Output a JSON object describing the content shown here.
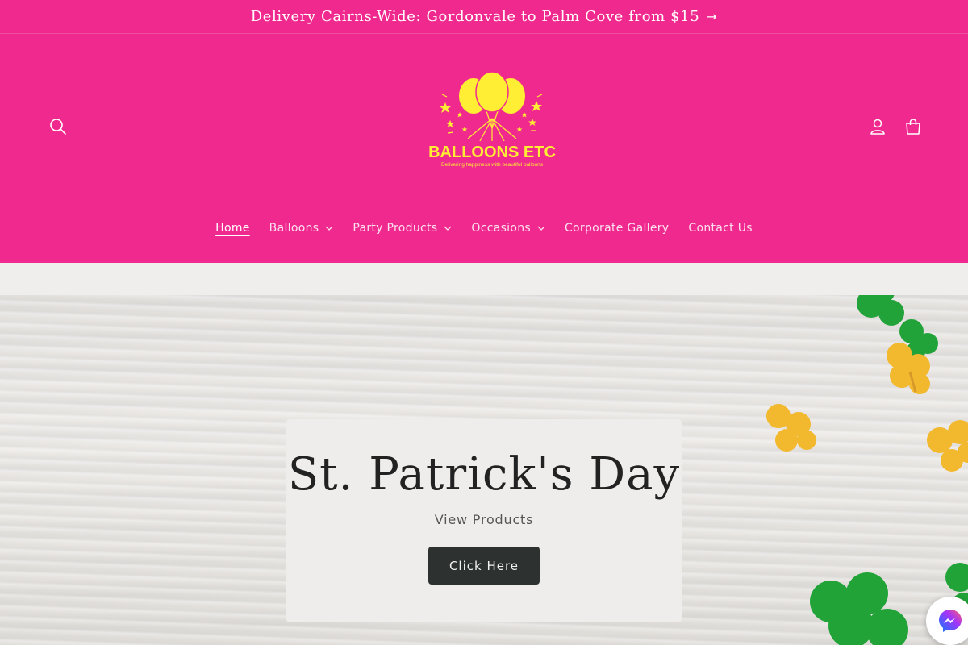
{
  "announcement": {
    "text": "Delivery Cairns-Wide: Gordonvale to Palm Cove from $15",
    "arrow": "→"
  },
  "header": {
    "icons": [
      "search-icon",
      "account-icon",
      "cart-icon"
    ],
    "background_color": "#f0298f",
    "logo": {
      "brand": "BALLOONS ETC",
      "tagline": "Delivering happiness with beautiful balloons",
      "color": "#ffee33"
    }
  },
  "nav": {
    "items": [
      {
        "label": "Home",
        "active": true,
        "has_dropdown": false
      },
      {
        "label": "Balloons",
        "active": false,
        "has_dropdown": true
      },
      {
        "label": "Party Products",
        "active": false,
        "has_dropdown": true
      },
      {
        "label": "Occasions",
        "active": false,
        "has_dropdown": true
      },
      {
        "label": "Corporate Gallery",
        "active": false,
        "has_dropdown": false
      },
      {
        "label": "Contact Us",
        "active": false,
        "has_dropdown": false
      }
    ]
  },
  "hero": {
    "title": "St. Patrick's Day",
    "subtitle": "View Products",
    "button_label": "Click Here",
    "button_color": "#2d312f"
  },
  "chat_widget": {
    "icon": "messenger-icon"
  }
}
